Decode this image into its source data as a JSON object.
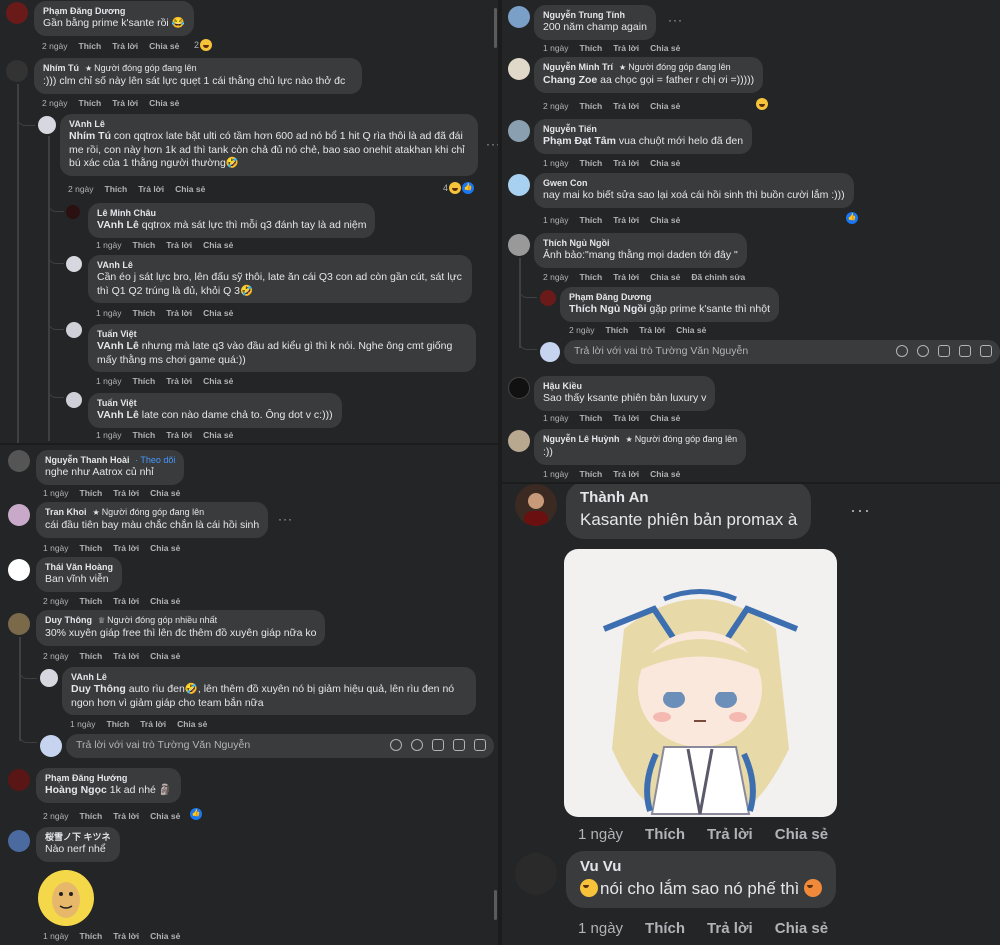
{
  "colors": {
    "bg": "#242526",
    "bubble": "#3a3b3c",
    "text": "#e4e6eb",
    "muted": "#b0b3b8",
    "link": "#4599ff",
    "like": "#1877f2"
  },
  "actions": {
    "like": "Thích",
    "reply": "Trả lời",
    "share": "Chia sẻ",
    "edit": "Đã chỉnh sửa"
  },
  "reply_placeholder": "Trả lời với vai trò Tường Văn Nguyễn",
  "badges": {
    "top_contributor": "Người đóng góp đang lên",
    "top_fan": "Người đóng góp nhiều nhất",
    "follow": "Theo dõi"
  },
  "tl": {
    "c1": {
      "name": "Phạm Đăng Dương",
      "text": "Gần bằng prime k'sante rồi 😂",
      "time": "2 ngày",
      "react_count": "2"
    },
    "c2": {
      "name": "Nhím Tú",
      "text": ":))) clm chỉ số này lên sát lực quẹt 1 cái thằng chủ lực nào thở đc",
      "time": "2 ngày"
    },
    "r1": {
      "name": "VAnh Lê",
      "mention": "Nhím Tú",
      "text": " con qqtrox late bật ulti có tầm hơn 600 ad nó bổ 1 hit Q rìa thôi là ad đã đái me rồi, con này hơn 1k ad thì tank còn chả đủ nó chẻ, bao sao onehit atakhan khi chỉ bú xác của 1 thằng người thường🤣",
      "time": "2 ngày",
      "react_count": "4"
    },
    "r2": {
      "name": "Lê Minh Châu",
      "mention": "VAnh Lê",
      "text": " qqtrox mà sát lực thì mỗi q3 đánh tay là ad niệm",
      "time": "1 ngày"
    },
    "r3": {
      "name": "VAnh Lê",
      "text": "Cần éo j sát lực bro, lên đấu sỹ thôi, late ăn cái Q3 con ad còn gần cút, sát lực thì Q1 Q2 trúng là đủ, khỏi Q 3🤣",
      "time": "1 ngày"
    },
    "r4": {
      "name": "Tuấn Việt",
      "mention": "VAnh Lê",
      "text": " nhưng mà late q3 vào đầu ad kiểu gì thì k nói. Nghe ông cmt giống mấy thằng ms chơi game quá:))",
      "time": "1 ngày"
    },
    "r5": {
      "name": "Tuấn Việt",
      "mention": "VAnh Lê",
      "text": " late con nào dame chả to. Ông dot v c:)))",
      "time": "1 ngày"
    }
  },
  "bl": {
    "c1": {
      "name": "Nguyễn Thanh Hoài",
      "text": "nghe như Aatrox củ nhỉ",
      "time": "1 ngày"
    },
    "c2": {
      "name": "Tran Khoi",
      "text": "cái đầu tiên bay màu chắc chắn là cái hồi sinh",
      "time": "1 ngày"
    },
    "c3": {
      "name": "Thái Văn Hoàng",
      "text": "Ban vĩnh viễn",
      "time": "2 ngày"
    },
    "c4": {
      "name": "Duy Thông",
      "text": "30% xuyên giáp free thì lên đc thêm đồ xuyên giáp nữa ko",
      "time": "2 ngày"
    },
    "r1": {
      "name": "VAnh Lê",
      "mention": "Duy Thông",
      "text": " auto rìu đen🤣, lên thêm đồ xuyên nó bị giảm hiệu quả, lên rìu đen nó ngon hơn vì giảm giáp cho team bắn nữa",
      "time": "1 ngày"
    },
    "c5": {
      "name": "Phạm Đăng Hướng",
      "mention": "Hoàng Ngọc",
      "text": " 1k ad nhé 🗿",
      "time": "2 ngày"
    },
    "c6": {
      "name": "桜雪ノ下 キツネ",
      "text": "Nào nerf nhể",
      "time": "1 ngày"
    }
  },
  "tr": {
    "c1": {
      "name": "Nguyễn Trung Tính",
      "text": "200 năm champ again",
      "time": "1 ngày"
    },
    "c2": {
      "name": "Nguyễn Minh Trí",
      "mention": "Chang Zoe",
      "text": " aa chọc gọi = father r chị ơi =)))))",
      "time": "2 ngày"
    },
    "c3": {
      "name": "Nguyễn Tiến",
      "mention": "Phạm Đạt Tâm",
      "text": " vua chuột mới helo đã đen",
      "time": "1 ngày"
    },
    "c4": {
      "name": "Gwen Con",
      "text": "nay mai ko biết sửa sao lại xoá cái hồi sinh thì buồn cười lắm :)))",
      "time": "1 ngày"
    },
    "c5": {
      "name": "Thích Ngủ Ngồi",
      "text": "Ảnh bảo:\"mang thằng mọi daden tới đây \"",
      "time": "2 ngày"
    },
    "r1": {
      "name": "Phạm Đăng Dương",
      "mention": "Thích Ngủ Ngồi",
      "text": " gặp prime k'sante thì nhột",
      "time": "2 ngày"
    },
    "c6": {
      "name": "Hậu Kiều",
      "text": "Sao thấy ksante phiên bản luxury v",
      "time": "1 ngày"
    },
    "c7": {
      "name": "Nguyễn Lê Huỳnh",
      "text": ":))",
      "time": "1 ngày"
    }
  },
  "br": {
    "c1": {
      "name": "Thành An",
      "text": "Kasante phiên bản promax à",
      "time": "1 ngày"
    },
    "c2": {
      "name": "Vu Vu",
      "text": "nói cho lắm sao nó phế thì",
      "time": "1 ngày"
    }
  }
}
